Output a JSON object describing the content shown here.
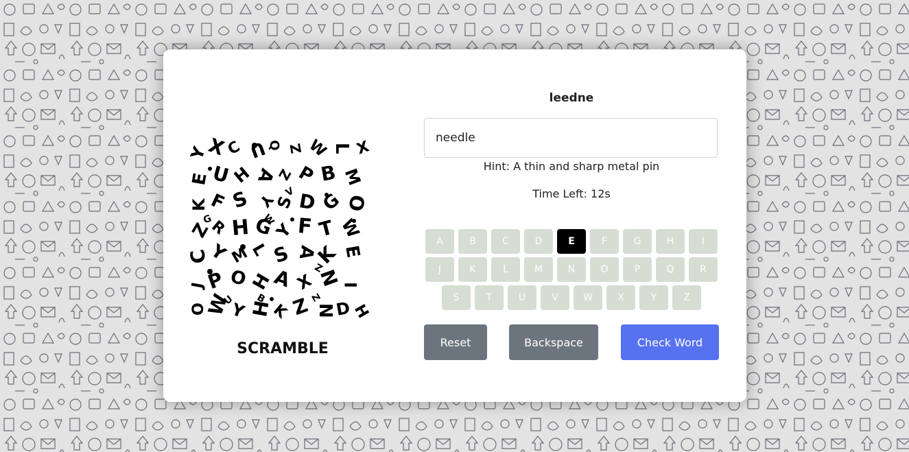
{
  "game": {
    "logo_text": "SCRAMBLE",
    "scrambled_word": "leedne",
    "answer_value": "needle",
    "hint_text": "Hint: A thin and sharp metal pin",
    "time_text": "Time Left: 12s"
  },
  "keyboard": {
    "rows": [
      [
        "A",
        "B",
        "C",
        "D",
        "E",
        "F",
        "G",
        "H",
        "I"
      ],
      [
        "J",
        "K",
        "L",
        "M",
        "N",
        "O",
        "P",
        "Q",
        "R"
      ],
      [
        "S",
        "T",
        "U",
        "V",
        "W",
        "X",
        "Y",
        "Z"
      ]
    ],
    "active_key": "E"
  },
  "buttons": {
    "reset": "Reset",
    "backspace": "Backspace",
    "check": "Check Word"
  },
  "colors": {
    "key_bg": "#d6ddd2",
    "key_active_bg": "#000000",
    "gray_button": "#6c757d",
    "primary_button": "#5672f0"
  }
}
